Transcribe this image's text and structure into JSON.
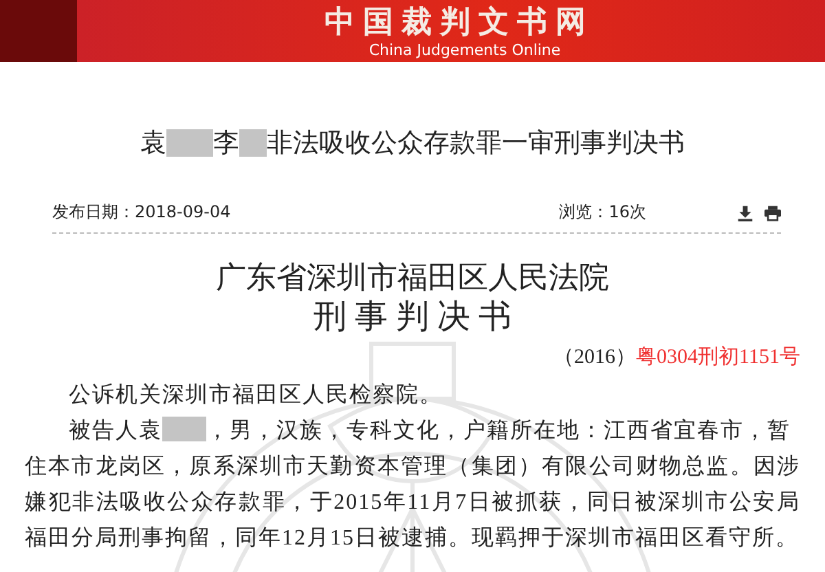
{
  "header": {
    "logo_title": "中国裁判文书网",
    "logo_subtitle": "China Judgements Online"
  },
  "document_title": [
    {
      "kind": "text",
      "text": "袁"
    },
    {
      "kind": "redacted"
    },
    {
      "kind": "text",
      "text": "李"
    },
    {
      "kind": "redacted"
    },
    {
      "kind": "text",
      "text": "非法吸收公众存款罪一审刑事判决书"
    }
  ],
  "meta": {
    "publish_label": "发布日期：",
    "publish_date": "2018-09-04",
    "views_label": "浏览：",
    "views": "16次"
  },
  "court": "广东省深圳市福田区人民法院",
  "doc_type": "刑 事 判 决 书",
  "case_number": {
    "year": "（2016）",
    "number": "粤0304刑初1151号"
  },
  "paragraphs": [
    [
      {
        "kind": "text",
        "text": "公诉机关深圳市福田区人民检察院。"
      }
    ],
    [
      {
        "kind": "text",
        "text": "被告人袁"
      },
      {
        "kind": "redacted"
      },
      {
        "kind": "text",
        "text": "，男，汉族，专科文化，户籍所在地：江西省宜春市，暂"
      },
      {
        "kind": "block",
        "text": "住本市龙岗区，原系深圳市天勤资本管理（集团）有限公司财物总监。因涉嫌犯非法吸收公众存款罪，于2015年11月7日被抓获，同日被深圳市公安局福田分局刑事拘留，同年12月15日被逮捕。现羁押于深圳市福田区看守所。"
      }
    ]
  ]
}
